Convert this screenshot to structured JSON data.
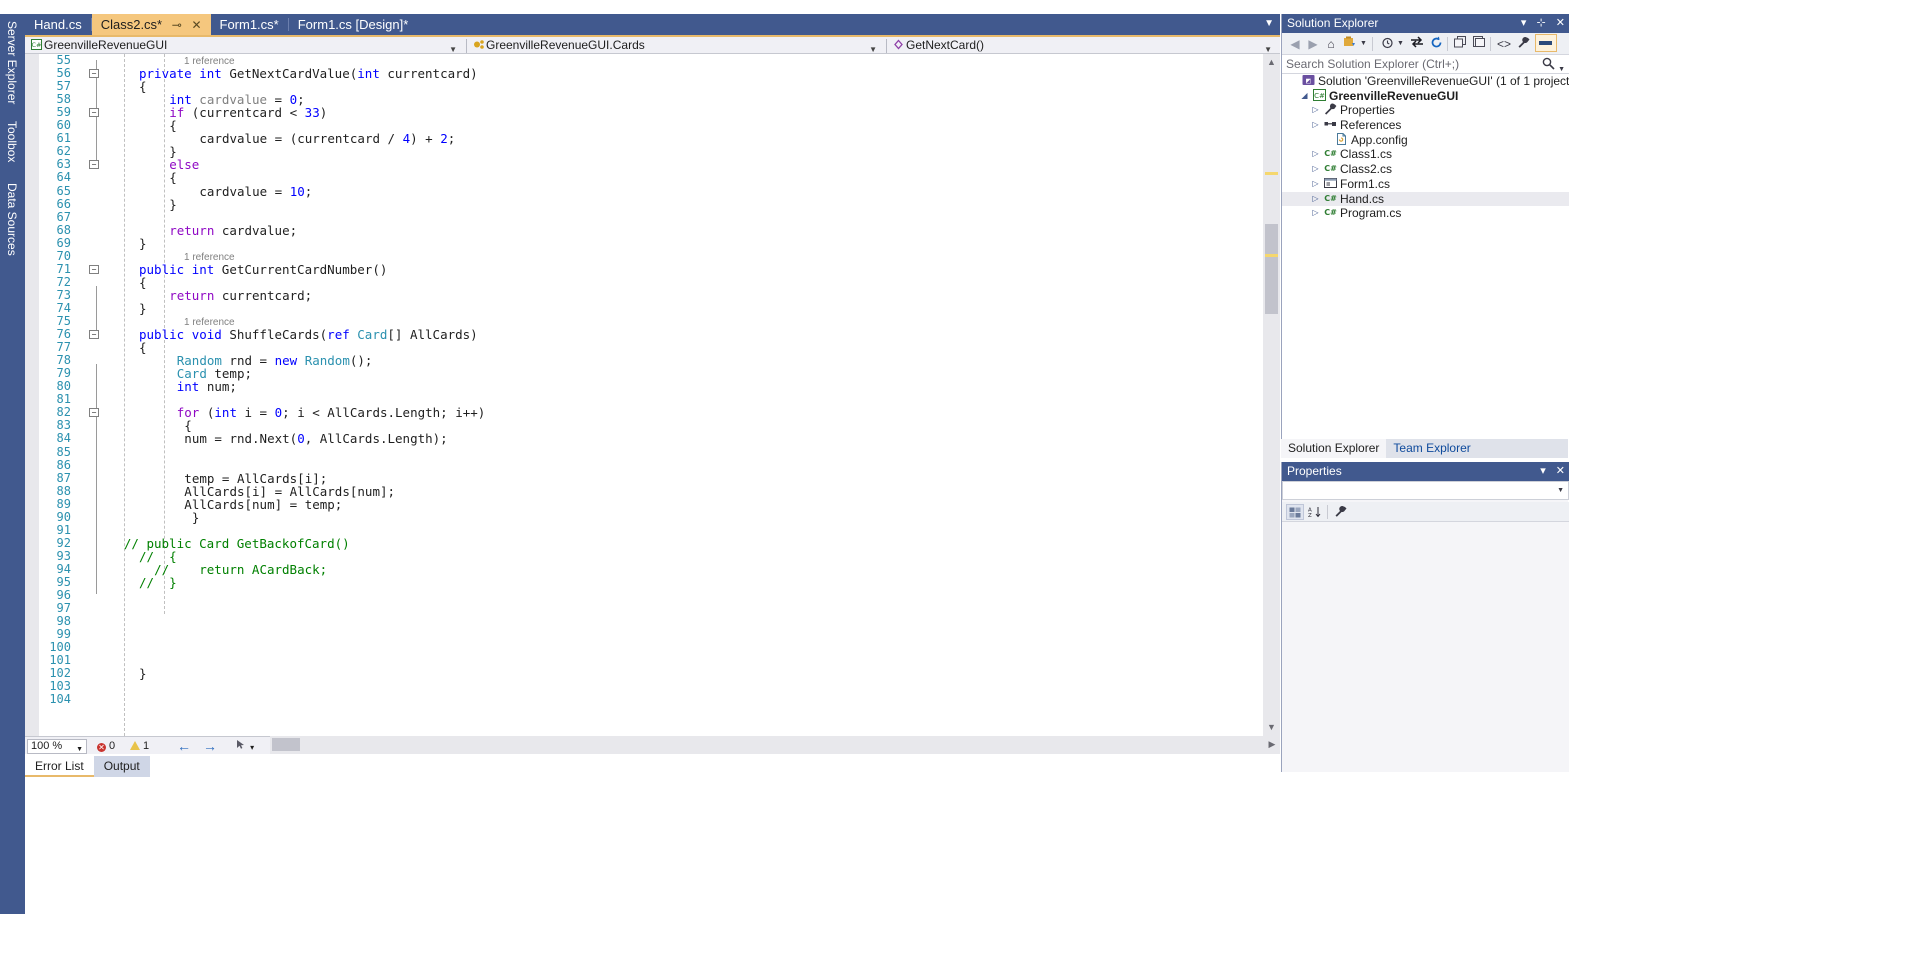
{
  "left_dock": {
    "tabs": [
      "Server Explorer",
      "Toolbox",
      "Data Sources"
    ]
  },
  "tabstrip": {
    "tabs": [
      {
        "label": "Hand.cs",
        "active": false
      },
      {
        "label": "Class2.cs*",
        "active": true,
        "pin": "⊸",
        "close": "✕"
      },
      {
        "label": "Form1.cs*",
        "active": false
      },
      {
        "label": "Form1.cs [Design]*",
        "active": false
      }
    ],
    "overflow_icon": "chevron-down-icon"
  },
  "navbar": {
    "project": {
      "icon": "csharp-icon",
      "label": "GreenvilleRevenueGUI"
    },
    "type": {
      "icon": "class-icon",
      "label": "GreenvilleRevenueGUI.Cards"
    },
    "member": {
      "icon": "method-icon",
      "label": "GetNextCard()"
    }
  },
  "editor": {
    "first_line": 55,
    "lines": [
      {
        "n": 55,
        "fold": "",
        "tokens": []
      },
      {
        "n": 56,
        "fold": "-",
        "ref": "1 reference",
        "tokens": [
          {
            "t": "private ",
            "c": "kw"
          },
          {
            "t": "int ",
            "c": "kw"
          },
          {
            "t": "GetNextCardValue",
            "c": "fn"
          },
          {
            "t": "(",
            "c": "pln"
          },
          {
            "t": "int",
            "c": "kw"
          },
          {
            "t": " currentcard)",
            "c": "pln"
          }
        ]
      },
      {
        "n": 57,
        "fold": "",
        "tokens": [
          {
            "t": "{",
            "c": "pln"
          }
        ]
      },
      {
        "n": 58,
        "fold": "",
        "indent": 4,
        "tokens": [
          {
            "t": "int",
            "c": "kw"
          },
          {
            "t": " ",
            "c": "pln"
          },
          {
            "t": "cardvalue",
            "c": "gry"
          },
          {
            "t": " = ",
            "c": "pln"
          },
          {
            "t": "0",
            "c": "num"
          },
          {
            "t": ";",
            "c": "pln"
          }
        ]
      },
      {
        "n": 59,
        "fold": "-",
        "indent": 4,
        "tokens": [
          {
            "t": "if",
            "c": "ctl"
          },
          {
            "t": " (currentcard < ",
            "c": "pln"
          },
          {
            "t": "33",
            "c": "num"
          },
          {
            "t": ")",
            "c": "pln"
          }
        ]
      },
      {
        "n": 60,
        "fold": "",
        "indent": 4,
        "tokens": [
          {
            "t": "{",
            "c": "pln"
          }
        ]
      },
      {
        "n": 61,
        "fold": "",
        "indent": 8,
        "tokens": [
          {
            "t": "cardvalue = (currentcard / ",
            "c": "pln"
          },
          {
            "t": "4",
            "c": "num"
          },
          {
            "t": ") + ",
            "c": "pln"
          },
          {
            "t": "2",
            "c": "num"
          },
          {
            "t": ";",
            "c": "pln"
          }
        ]
      },
      {
        "n": 62,
        "fold": "",
        "indent": 4,
        "tokens": [
          {
            "t": "}",
            "c": "pln"
          }
        ]
      },
      {
        "n": 63,
        "fold": "-",
        "indent": 4,
        "tokens": [
          {
            "t": "else",
            "c": "ctl"
          }
        ]
      },
      {
        "n": 64,
        "fold": "",
        "indent": 4,
        "tokens": [
          {
            "t": "{",
            "c": "pln"
          }
        ]
      },
      {
        "n": 65,
        "fold": "",
        "indent": 8,
        "tokens": [
          {
            "t": "cardvalue = ",
            "c": "pln"
          },
          {
            "t": "10",
            "c": "num"
          },
          {
            "t": ";",
            "c": "pln"
          }
        ]
      },
      {
        "n": 66,
        "fold": "",
        "indent": 4,
        "tokens": [
          {
            "t": "}",
            "c": "pln"
          }
        ]
      },
      {
        "n": 67,
        "fold": "",
        "tokens": []
      },
      {
        "n": 68,
        "fold": "",
        "indent": 4,
        "tokens": [
          {
            "t": "return",
            "c": "ctl"
          },
          {
            "t": " cardvalue;",
            "c": "pln"
          }
        ]
      },
      {
        "n": 69,
        "fold": "",
        "tokens": [
          {
            "t": "}",
            "c": "pln"
          }
        ]
      },
      {
        "n": 70,
        "fold": "",
        "tokens": []
      },
      {
        "n": 71,
        "fold": "-",
        "ref": "1 reference",
        "tokens": [
          {
            "t": "public ",
            "c": "kw"
          },
          {
            "t": "int ",
            "c": "kw"
          },
          {
            "t": "GetCurrentCardNumber",
            "c": "fn"
          },
          {
            "t": "()",
            "c": "pln"
          }
        ]
      },
      {
        "n": 72,
        "fold": "",
        "tokens": [
          {
            "t": "{",
            "c": "pln"
          }
        ]
      },
      {
        "n": 73,
        "fold": "",
        "indent": 4,
        "tokens": [
          {
            "t": "return",
            "c": "ctl"
          },
          {
            "t": " currentcard;",
            "c": "pln"
          }
        ]
      },
      {
        "n": 74,
        "fold": "",
        "tokens": [
          {
            "t": "}",
            "c": "pln"
          }
        ]
      },
      {
        "n": 75,
        "fold": "",
        "tokens": []
      },
      {
        "n": 76,
        "fold": "-",
        "ref": "1 reference",
        "tokens": [
          {
            "t": "public ",
            "c": "kw"
          },
          {
            "t": "void ",
            "c": "kw"
          },
          {
            "t": "ShuffleCards",
            "c": "fn"
          },
          {
            "t": "(",
            "c": "pln"
          },
          {
            "t": "ref ",
            "c": "kw"
          },
          {
            "t": "Card",
            "c": "typ"
          },
          {
            "t": "[] AllCards)",
            "c": "pln"
          }
        ]
      },
      {
        "n": 77,
        "fold": "",
        "tokens": [
          {
            "t": "{",
            "c": "pln"
          }
        ]
      },
      {
        "n": 78,
        "fold": "",
        "indent": 5,
        "tokens": [
          {
            "t": "Random",
            "c": "typ"
          },
          {
            "t": " rnd = ",
            "c": "pln"
          },
          {
            "t": "new",
            "c": "kw"
          },
          {
            "t": " ",
            "c": "pln"
          },
          {
            "t": "Random",
            "c": "typ"
          },
          {
            "t": "();",
            "c": "pln"
          }
        ]
      },
      {
        "n": 79,
        "fold": "",
        "indent": 5,
        "tokens": [
          {
            "t": "Card",
            "c": "typ"
          },
          {
            "t": " temp;",
            "c": "pln"
          }
        ]
      },
      {
        "n": 80,
        "fold": "",
        "indent": 5,
        "tokens": [
          {
            "t": "int",
            "c": "kw"
          },
          {
            "t": " num;",
            "c": "pln"
          }
        ]
      },
      {
        "n": 81,
        "fold": "",
        "tokens": []
      },
      {
        "n": 82,
        "fold": "-",
        "indent": 5,
        "tokens": [
          {
            "t": "for",
            "c": "ctl"
          },
          {
            "t": " (",
            "c": "pln"
          },
          {
            "t": "int",
            "c": "kw"
          },
          {
            "t": " i = ",
            "c": "pln"
          },
          {
            "t": "0",
            "c": "num"
          },
          {
            "t": "; i < AllCards.Length; i++)",
            "c": "pln"
          }
        ]
      },
      {
        "n": 83,
        "fold": "",
        "indent": 6,
        "tokens": [
          {
            "t": "{",
            "c": "pln"
          }
        ]
      },
      {
        "n": 84,
        "fold": "",
        "indent": 6,
        "tokens": [
          {
            "t": "num = rnd.Next(",
            "c": "pln"
          },
          {
            "t": "0",
            "c": "num"
          },
          {
            "t": ", AllCards.Length);",
            "c": "pln"
          }
        ]
      },
      {
        "n": 85,
        "fold": "",
        "tokens": []
      },
      {
        "n": 86,
        "fold": "",
        "tokens": []
      },
      {
        "n": 87,
        "fold": "",
        "indent": 6,
        "tokens": [
          {
            "t": "temp = AllCards[i];",
            "c": "pln"
          }
        ]
      },
      {
        "n": 88,
        "fold": "",
        "indent": 6,
        "tokens": [
          {
            "t": "AllCards[i] = AllCards[num];",
            "c": "pln"
          }
        ]
      },
      {
        "n": 89,
        "fold": "",
        "indent": 6,
        "tokens": [
          {
            "t": "AllCards[num] = temp;",
            "c": "pln"
          }
        ]
      },
      {
        "n": 90,
        "fold": "",
        "indent": 7,
        "tokens": [
          {
            "t": "}",
            "c": "pln"
          }
        ]
      },
      {
        "n": 91,
        "fold": "",
        "tokens": []
      },
      {
        "n": 92,
        "fold": "",
        "indent": -2,
        "tokens": [
          {
            "t": "// public Card GetBackofCard()",
            "c": "cmt"
          }
        ]
      },
      {
        "n": 93,
        "fold": "",
        "indent": 0,
        "tokens": [
          {
            "t": "//  {",
            "c": "cmt"
          }
        ]
      },
      {
        "n": 94,
        "fold": "",
        "indent": 2,
        "tokens": [
          {
            "t": "//    return ACardBack;",
            "c": "cmt"
          }
        ]
      },
      {
        "n": 95,
        "fold": "",
        "indent": 0,
        "tokens": [
          {
            "t": "//  }",
            "c": "cmt"
          }
        ]
      },
      {
        "n": 96,
        "fold": "",
        "tokens": []
      },
      {
        "n": 97,
        "fold": "",
        "tokens": []
      },
      {
        "n": 98,
        "fold": "",
        "tokens": []
      },
      {
        "n": 99,
        "fold": "",
        "tokens": []
      },
      {
        "n": 100,
        "fold": "",
        "tokens": []
      },
      {
        "n": 101,
        "fold": "",
        "tokens": []
      },
      {
        "n": 102,
        "fold": "",
        "tokens": [
          {
            "t": "}",
            "c": "pln"
          }
        ]
      },
      {
        "n": 103,
        "fold": "",
        "tokens": []
      },
      {
        "n": 104,
        "fold": "",
        "tokens": []
      }
    ]
  },
  "editor_statusbar": {
    "zoom": "100 %",
    "error_count": "0",
    "warning_count": "1",
    "nav_back": "←",
    "nav_forward": "→",
    "tool_icon": "pointer-icon",
    "tool_arrow": "▾"
  },
  "bottom_tabs": [
    {
      "label": "Error List",
      "active": true
    },
    {
      "label": "Output",
      "active": false
    }
  ],
  "solution_explorer": {
    "title": "Solution Explorer",
    "window_controls": {
      "dropdown": "▾",
      "pin": "⊹",
      "close": "✕"
    },
    "toolbar": [
      "back-icon",
      "forward-icon",
      "home-icon",
      "pending-changes-icon",
      "pending-changes-dropdown-icon",
      "show-all-files-icon",
      "show-all-files-dropdown-icon",
      "sync-icon",
      "refresh-icon",
      "collapse-all-icon",
      "properties-window-icon",
      "view-code-icon",
      "properties-icon",
      "preview-selected-items-icon"
    ],
    "search_placeholder": "Search Solution Explorer (Ctrl+;)",
    "tree": [
      {
        "label": "Solution 'GreenvilleRevenueGUI' (1 of 1 project)",
        "indent": 0,
        "expander": "",
        "icon": "solution-icon",
        "bold": false,
        "selected": false
      },
      {
        "label": "GreenvilleRevenueGUI",
        "indent": 1,
        "expander": "◢",
        "icon": "csharp-project-icon",
        "bold": true,
        "selected": false
      },
      {
        "label": "Properties",
        "indent": 2,
        "expander": "▷",
        "icon": "wrench-icon",
        "bold": false,
        "selected": false
      },
      {
        "label": "References",
        "indent": 2,
        "expander": "▷",
        "icon": "references-icon",
        "bold": false,
        "selected": false
      },
      {
        "label": "App.config",
        "indent": 3,
        "expander": "",
        "icon": "config-file-icon",
        "bold": false,
        "selected": false
      },
      {
        "label": "Class1.cs",
        "indent": 2,
        "expander": "▷",
        "icon": "csharp-file-icon",
        "bold": false,
        "selected": false
      },
      {
        "label": "Class2.cs",
        "indent": 2,
        "expander": "▷",
        "icon": "csharp-file-icon",
        "bold": false,
        "selected": false
      },
      {
        "label": "Form1.cs",
        "indent": 2,
        "expander": "▷",
        "icon": "form-file-icon",
        "bold": false,
        "selected": false
      },
      {
        "label": "Hand.cs",
        "indent": 2,
        "expander": "▷",
        "icon": "csharp-file-icon",
        "bold": false,
        "selected": true
      },
      {
        "label": "Program.cs",
        "indent": 2,
        "expander": "▷",
        "icon": "csharp-file-icon",
        "bold": false,
        "selected": false
      }
    ],
    "bottom_tabs": [
      {
        "label": "Solution Explorer",
        "active": true
      },
      {
        "label": "Team Explorer",
        "active": false
      }
    ]
  },
  "properties": {
    "title": "Properties",
    "window_controls": {
      "dropdown": "▾",
      "close": "✕"
    },
    "combo_value": "",
    "toolbar": [
      "categorized-icon",
      "alphabetical-icon",
      "properties-icon"
    ]
  },
  "colors": {
    "chrome_blue": "#41598e",
    "active_tab": "#f5c77e",
    "accent_orange": "#e8b96a",
    "keyword_blue": "#0000ff",
    "control_purple": "#8f08c4",
    "type_teal": "#2b91af",
    "comment_green": "#008000",
    "linenum_teal": "#2b91af"
  }
}
